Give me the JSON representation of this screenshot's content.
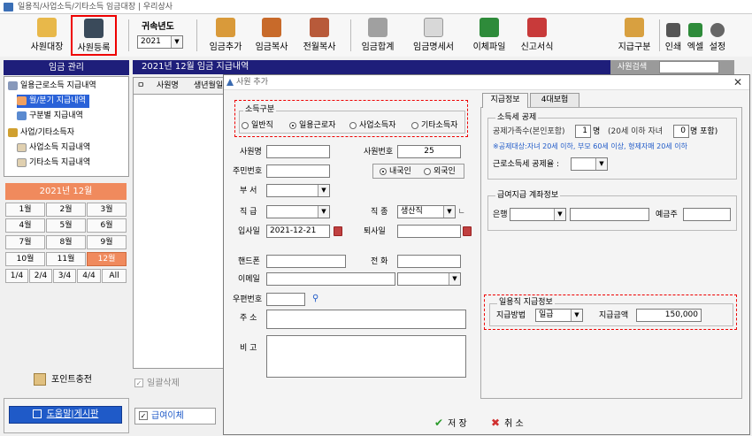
{
  "window": {
    "title": "일용직/사업소득/기타소득 임금대장 | 우리상사"
  },
  "toolbar": {
    "items": [
      {
        "label": "사원대장",
        "icon": "employee-ledger-icon"
      },
      {
        "label": "사원등록",
        "icon": "add-employee-icon"
      },
      {
        "label": "임금추가",
        "icon": "add-wage-icon"
      },
      {
        "label": "임금복사",
        "icon": "copy-wage-icon"
      },
      {
        "label": "전월복사",
        "icon": "copy-last-month-icon"
      },
      {
        "label": "임금합계",
        "icon": "wage-total-icon"
      },
      {
        "label": "임금명세서",
        "icon": "pay-statement-icon"
      },
      {
        "label": "이체파일",
        "icon": "transfer-file-icon"
      },
      {
        "label": "신고서식",
        "icon": "report-form-icon"
      },
      {
        "label": "지급구분",
        "icon": "payment-type-icon"
      },
      {
        "label": "인쇄",
        "icon": "print-icon"
      },
      {
        "label": "엑셀",
        "icon": "excel-icon"
      },
      {
        "label": "설정",
        "icon": "settings-icon"
      }
    ],
    "year_label": "귀속년도",
    "year_value": "2021"
  },
  "sidebar": {
    "header": "임금 관리",
    "tree": [
      {
        "label": "일용근로소득 지급내역"
      },
      {
        "label": "월/분기 지급내역"
      },
      {
        "label": "구분별 지급내역"
      },
      {
        "label": "사업/기타소득자"
      },
      {
        "label": "사업소득 지급내역"
      },
      {
        "label": "기타소득 지급내역"
      }
    ],
    "month_header": "2021년 12월",
    "months": [
      "1월",
      "2월",
      "3월",
      "4월",
      "5월",
      "6월",
      "7월",
      "8월",
      "9월",
      "10월",
      "11월",
      "12월"
    ],
    "quarters": [
      "1/4",
      "2/4",
      "3/4",
      "4/4",
      "All"
    ],
    "point_charge": "포인트충전",
    "help_board": "도움말|게시판"
  },
  "main": {
    "header": "2021년 12월 임금 지급내역",
    "search_label": "사원검색",
    "columns": [
      "ㅁ",
      "사원명",
      "생년월일"
    ],
    "bulk_delete": "일괄삭제",
    "wage_transfer": "급여이체"
  },
  "dialog": {
    "title": "사원 추가",
    "income_type": {
      "title": "소득구분",
      "options": [
        "일반직",
        "일용근로자",
        "사업소득자",
        "기타소득자"
      ],
      "selected": "일용근로자"
    },
    "fields": {
      "emp_name": "사원명",
      "emp_no": "사원번호",
      "emp_no_value": "25",
      "resident_no": "주민번호",
      "domestic": "내국인",
      "foreign": "외국인",
      "dept": "부 서",
      "position": "직 급",
      "job_type": "직 종",
      "job_type_value": "생산직",
      "hire_date": "입사일",
      "hire_date_value": "2021-12-21",
      "leave_date": "퇴사일",
      "mobile": "핸드폰",
      "phone": "전 화",
      "email": "이메일",
      "zip": "우편번호",
      "address": "주 소",
      "note": "비 고"
    },
    "tabs": [
      "지급정보",
      "4대보험"
    ],
    "tax": {
      "title": "소득세 공제",
      "dependents_label": "공제가족수(본인포함)",
      "dependents_value": "1",
      "dependents_unit": "명",
      "children_label": "(20세 이하 자녀",
      "children_value": "0",
      "children_unit": "명 포함)",
      "note": "※공제대상:자녀 20세 이하, 부모 60세 이상, 형제자매 20세 이하",
      "rate_label": "근로소득세 공제율 :"
    },
    "bank": {
      "title": "급여지급 계좌정보",
      "bank_label": "은행",
      "holder_label": "예금주"
    },
    "daily": {
      "title": "일용직 지급정보",
      "method_label": "지급방법",
      "method_value": "일급",
      "amount_label": "지급금액",
      "amount_value": "150,000"
    },
    "save": "저 장",
    "cancel": "취 소"
  }
}
